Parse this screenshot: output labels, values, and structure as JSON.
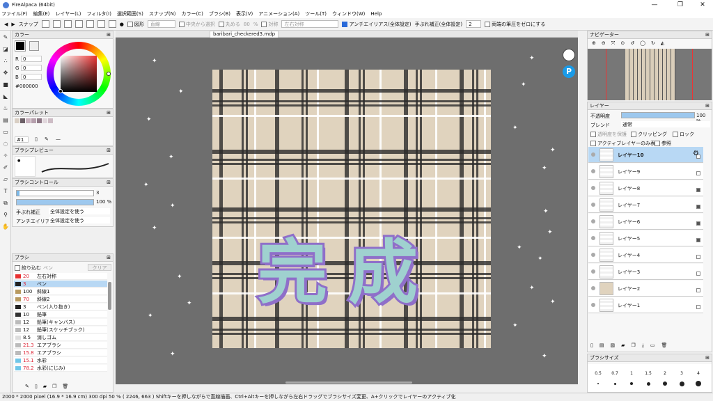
{
  "app": {
    "title": "FireAlpaca (64bit)",
    "win_min": "—",
    "win_max": "❐",
    "win_close": "✕"
  },
  "menu": [
    "ファイル(F)",
    "編集(E)",
    "レイヤー(L)",
    "フィルタ(I)",
    "選択範囲(S)",
    "スナップ(N)",
    "カラー(C)",
    "ブラシ(B)",
    "表示(V)",
    "アニメーション(A)",
    "ツール(T)",
    "ウィンドウ(W)",
    "Help"
  ],
  "toolbar": {
    "snap": "スナップ",
    "shape": "図形",
    "shape_val": "直線",
    "center": "中央から選択",
    "round": "丸める",
    "round_val": "80",
    "unit": "%",
    "symmetry": "対称",
    "sym_val": "左右対称",
    "antialias": "アンチエイリアス(全体設定)",
    "correction": "手ぶれ補正(全体設定)",
    "correction_val": "2",
    "pressure": "両端の筆圧をゼロにする"
  },
  "color_panel": {
    "title": "カラー",
    "r_label": "R",
    "r": "0",
    "g_label": "G",
    "g": "0",
    "b_label": "B",
    "b": "0",
    "hex": "#000000",
    "primary": "#000000"
  },
  "palette": {
    "title": "カラーパレット",
    "num": "#1"
  },
  "brush_preview": {
    "title": "ブラシプレビュー"
  },
  "brush_control": {
    "title": "ブラシコントロール",
    "size": "3",
    "opacity": "100 %",
    "correction_label": "手ぶれ補正",
    "correction": "全体設定を使う",
    "aa_label": "アンチエイリアス",
    "aa": "全体設定を使う"
  },
  "brush": {
    "title": "ブラシ",
    "filter": "絞り込む",
    "filter_placeholder": "ペン",
    "clear": "クリア",
    "items": [
      {
        "size": "20",
        "name": "左右対称",
        "color": "#e83030",
        "red": true
      },
      {
        "size": "3",
        "name": "ペン",
        "color": "#222222",
        "red": true,
        "active": true
      },
      {
        "size": "100",
        "name": "斜線1",
        "color": "#b89a60"
      },
      {
        "size": "70",
        "name": "斜線2",
        "color": "#b89a60",
        "red": true
      },
      {
        "size": "3",
        "name": "ペン(入り抜き)",
        "color": "#222222"
      },
      {
        "size": "10",
        "name": "鉛筆",
        "color": "#333333"
      },
      {
        "size": "12",
        "name": "鉛筆(キャンバス)",
        "color": "#bbbbbb"
      },
      {
        "size": "12",
        "name": "鉛筆(スケッチブック)",
        "color": "#bbbbbb"
      },
      {
        "size": "8.5",
        "name": "消しゴム",
        "color": "#dddddd"
      },
      {
        "size": "21.3",
        "name": "エアブラシ",
        "color": "#bbbbbb",
        "red": true
      },
      {
        "size": "15.8",
        "name": "エアブラシ",
        "color": "#bbbbbb",
        "red": true
      },
      {
        "size": "15.1",
        "name": "水彩",
        "color": "#6fc6e8",
        "red": true
      },
      {
        "size": "78.2",
        "name": "水彩(にじみ)",
        "color": "#6fc6e8",
        "red": true
      }
    ]
  },
  "document": {
    "tab": "baribari_checkered3.mdp",
    "artwork_text": "完成"
  },
  "navigator": {
    "title": "ナビゲーター"
  },
  "layers": {
    "title": "レイヤー",
    "opacity_label": "不透明度",
    "opacity": "100 %",
    "blend_label": "ブレンド",
    "blend": "通常",
    "protect": "透明度を保護",
    "clipping": "クリッピング",
    "lock": "ロック",
    "active_only": "アクティブレイヤーのみ表示",
    "reference": "参照",
    "items": [
      "レイヤー10",
      "レイヤー9",
      "レイヤー8",
      "レイヤー7",
      "レイヤー6",
      "レイヤー5",
      "レイヤー4",
      "レイヤー3",
      "レイヤー2",
      "レイヤー1"
    ]
  },
  "brush_size": {
    "title": "ブラシサイズ",
    "sizes": [
      "0.5",
      "0.7",
      "1",
      "1.5",
      "2",
      "3",
      "4"
    ]
  },
  "status": "2000 * 2000 pixel   (16.9 * 16.9 cm)   300 dpi   50 %   ( 2246, 663 )   Shiftキーを押しながらで直線描画、Ctrl+Altキーを押しながら左右ドラッグでブラシサイズ変更、A+クリックでレイヤーのアクティブ化",
  "colors": {
    "accent": "#2a6ad9",
    "active_row": "#b8d8f4",
    "canvas_bg": "#6e6e6e",
    "paper": "#e0d3be",
    "kanji_fill": "#9fd1cf",
    "kanji_outline": "#8f6fc9"
  }
}
